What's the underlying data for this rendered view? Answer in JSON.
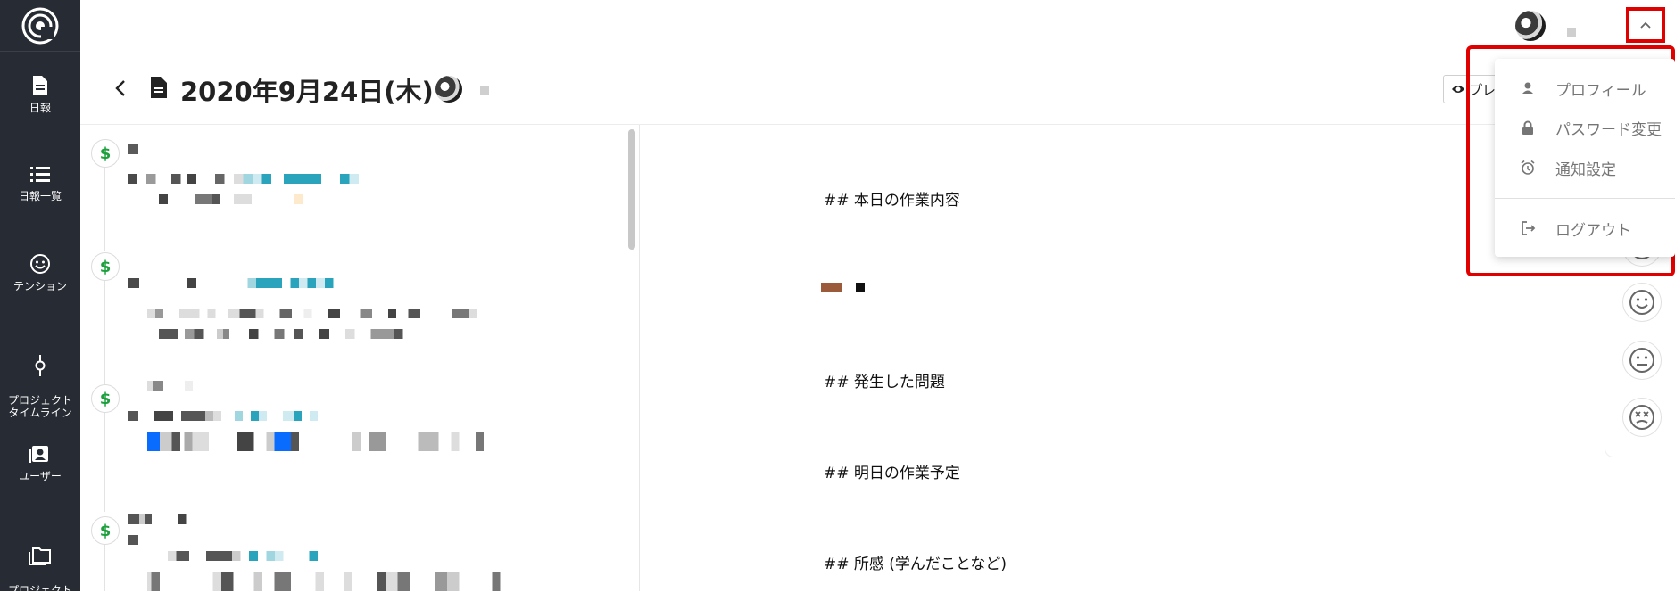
{
  "sidebar": {
    "items": [
      {
        "label": "日報",
        "icon": "file-document-icon"
      },
      {
        "label": "日報一覧",
        "icon": "list-icon"
      },
      {
        "label": "テンション",
        "icon": "smiley-icon"
      },
      {
        "label": "プロジェクト\nタイムライン",
        "icon": "timeline-node-icon"
      },
      {
        "label": "ユーザー",
        "icon": "account-box-icon"
      },
      {
        "label": "プロジェクト\n管理",
        "icon": "folder-multiple-icon"
      }
    ]
  },
  "header": {
    "page_title": "2020年9月24日(木)",
    "preview_label": "プレ"
  },
  "markdown": {
    "h1": "## 本日の作業内容",
    "h2": "## 発生した問題",
    "h3": "## 明日の作業予定",
    "h4": "## 所感 (学んだことなど)"
  },
  "user_menu": {
    "items": [
      {
        "label": "プロフィール",
        "icon": "account-icon"
      },
      {
        "label": "パスワード変更",
        "icon": "lock-icon"
      },
      {
        "label": "通知設定",
        "icon": "alarm-icon"
      },
      {
        "label": "ログアウト",
        "icon": "logout-icon"
      }
    ]
  },
  "colors": {
    "sidebar_bg": "#272b33",
    "highlight": "#e10000",
    "badge_green": "#1ba03c",
    "accent_teal": "#2aa4bd",
    "accent_blue": "#0a6cff"
  }
}
